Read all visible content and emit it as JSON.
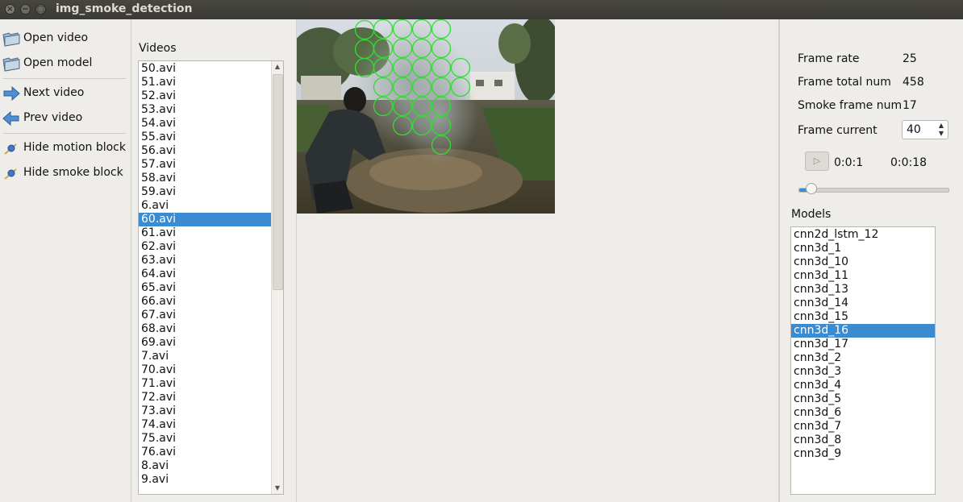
{
  "window": {
    "title": "img_smoke_detection"
  },
  "toolbar": {
    "open_video": "Open video",
    "open_model": "Open model",
    "next_video": "Next video",
    "prev_video": "Prev video",
    "hide_motion_block": "Hide motion block",
    "hide_smoke_block": "Hide smoke block"
  },
  "videos": {
    "label": "Videos",
    "selected": "60.avi",
    "items": [
      "50.avi",
      "51.avi",
      "52.avi",
      "53.avi",
      "54.avi",
      "55.avi",
      "56.avi",
      "57.avi",
      "58.avi",
      "59.avi",
      "6.avi",
      "60.avi",
      "61.avi",
      "62.avi",
      "63.avi",
      "64.avi",
      "65.avi",
      "66.avi",
      "67.avi",
      "68.avi",
      "69.avi",
      "7.avi",
      "70.avi",
      "71.avi",
      "72.avi",
      "73.avi",
      "74.avi",
      "75.avi",
      "76.avi",
      "8.avi",
      "9.avi"
    ]
  },
  "info": {
    "frame_rate_label": "Frame rate",
    "frame_rate_value": "25",
    "frame_total_label": "Frame total num",
    "frame_total_value": "458",
    "smoke_frame_label": "Smoke frame num",
    "smoke_frame_value": "17",
    "frame_current_label": "Frame current",
    "frame_current_value": "40",
    "time_current": "0:0:1",
    "time_total": "0:0:18",
    "slider_fraction": 0.087
  },
  "models": {
    "label": "Models",
    "selected": "cnn3d_16",
    "items": [
      "cnn2d_lstm_12",
      "cnn3d_1",
      "cnn3d_10",
      "cnn3d_11",
      "cnn3d_13",
      "cnn3d_14",
      "cnn3d_15",
      "cnn3d_16",
      "cnn3d_17",
      "cnn3d_2",
      "cnn3d_3",
      "cnn3d_4",
      "cnn3d_5",
      "cnn3d_6",
      "cnn3d_7",
      "cnn3d_8",
      "cnn3d_9"
    ]
  },
  "colors": {
    "selection": "#3a8bd0",
    "detection_circle": "#2ee02e"
  }
}
